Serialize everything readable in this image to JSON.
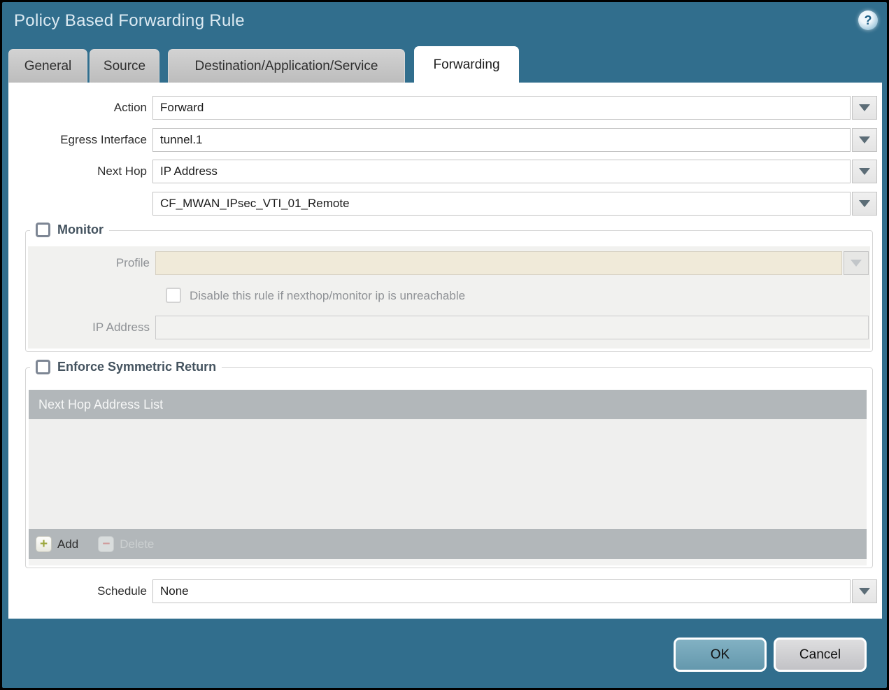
{
  "dialog": {
    "title": "Policy Based Forwarding Rule",
    "help_glyph": "?"
  },
  "tabs": [
    {
      "label": "General",
      "active": false
    },
    {
      "label": "Source",
      "active": false
    },
    {
      "label": "Destination/Application/Service",
      "active": false
    },
    {
      "label": "Forwarding",
      "active": true
    }
  ],
  "form": {
    "action": {
      "label": "Action",
      "value": "Forward"
    },
    "egress_interface": {
      "label": "Egress Interface",
      "value": "tunnel.1"
    },
    "next_hop": {
      "label": "Next Hop",
      "value": "IP Address"
    },
    "next_hop_address": {
      "value": "CF_MWAN_IPsec_VTI_01_Remote"
    },
    "schedule": {
      "label": "Schedule",
      "value": "None"
    }
  },
  "monitor": {
    "legend": "Monitor",
    "checked": false,
    "profile": {
      "label": "Profile",
      "value": ""
    },
    "disable_rule": {
      "label": "Disable this rule if nexthop/monitor ip is unreachable",
      "checked": false
    },
    "ip_address": {
      "label": "IP Address",
      "value": ""
    }
  },
  "symmetric_return": {
    "legend": "Enforce Symmetric Return",
    "checked": false,
    "table": {
      "header": "Next Hop Address List",
      "rows": []
    },
    "add_button": "Add",
    "delete_button": "Delete",
    "add_glyph": "+",
    "delete_glyph": "−"
  },
  "footer": {
    "ok_button": "OK",
    "cancel_button": "Cancel"
  },
  "colors": {
    "frame_teal": "#316e8d",
    "tab_inactive_gray": "#c4c4c4",
    "disabled_field_beige": "#f0ead9",
    "table_header_gray": "#b2b7ba",
    "ok_button_blue": "#6fa3b7",
    "add_plus_green": "#9aa63a",
    "delete_minus_red": "#cf9a9a",
    "legend_text": "#44535f"
  }
}
